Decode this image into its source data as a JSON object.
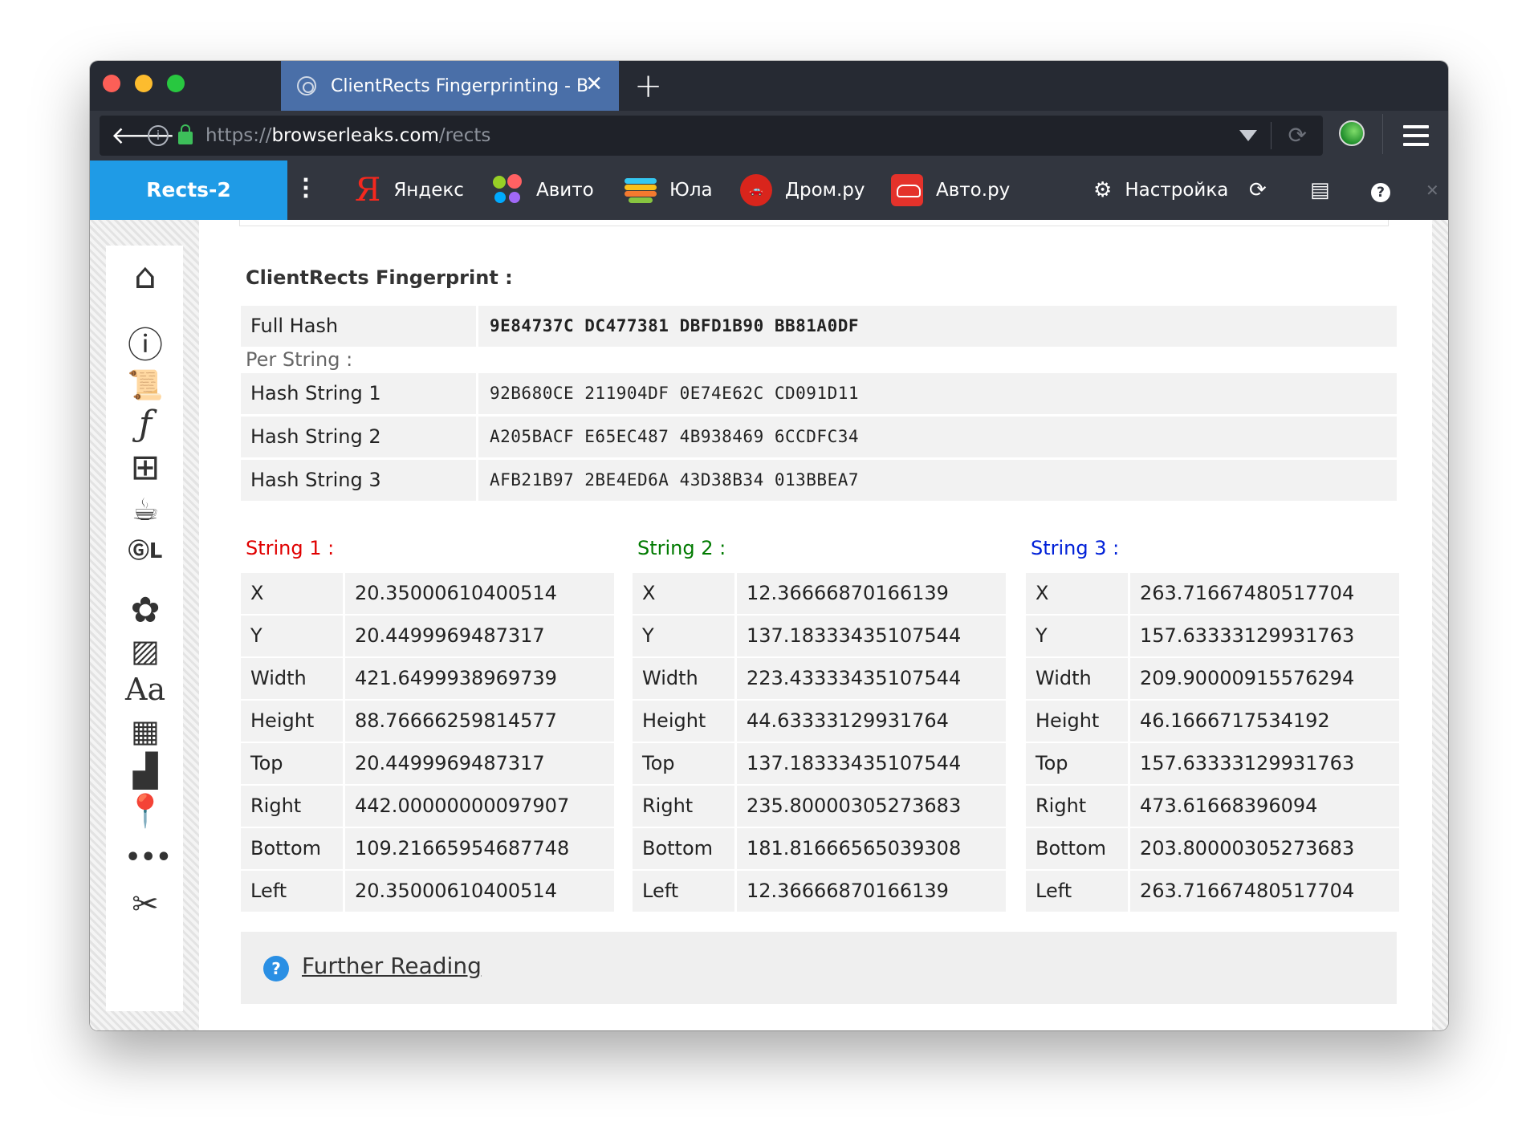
{
  "browser": {
    "tab_title": "ClientRects Fingerprinting - B",
    "url_scheme": "https://",
    "url_host": "browserleaks.com",
    "url_path": "/rects"
  },
  "bookmarks": {
    "active": "Rects-2",
    "items": [
      {
        "label": "Яндекс",
        "icon": "yandex-icon"
      },
      {
        "label": "Авито",
        "icon": "avito-icon"
      },
      {
        "label": "Юла",
        "icon": "yula-icon"
      },
      {
        "label": "Дром.ру",
        "icon": "drom-icon"
      },
      {
        "label": "Авто.ру",
        "icon": "autoru-icon"
      }
    ],
    "settings_label": "Настройка"
  },
  "sidebar": {
    "icons": [
      "home-icon",
      "info-icon",
      "javascript-icon",
      "flash-icon",
      "windows-icon",
      "java-icon",
      "webgl-icon",
      "canvas-icon",
      "image-icon",
      "fonts-icon",
      "firewall-icon",
      "stairs-icon",
      "location-icon",
      "more-icon",
      "tools-icon"
    ]
  },
  "fingerprint": {
    "title": "ClientRects Fingerprint :",
    "full_hash_label": "Full Hash",
    "full_hash": "9E84737C DC477381 DBFD1B90 BB81A0DF",
    "per_string_label": "Per String :",
    "strings": [
      {
        "label": "Hash String 1",
        "hash": "92B680CE 211904DF 0E74E62C CD091D11"
      },
      {
        "label": "Hash String 2",
        "hash": "A205BACF E65EC487 4B938469 6CCDFC34"
      },
      {
        "label": "Hash String 3",
        "hash": "AFB21B97 2BE4ED6A 43D38B34 013BBEA7"
      }
    ]
  },
  "rects": {
    "keys": [
      "X",
      "Y",
      "Width",
      "Height",
      "Top",
      "Right",
      "Bottom",
      "Left"
    ],
    "columns": [
      {
        "title": "String 1 :",
        "color": "#e00000",
        "values": [
          "20.35000610400514",
          "20.4499969487317",
          "421.6499938969739",
          "88.76666259814577",
          "20.4499969487317",
          "442.00000000097907",
          "109.21665954687748",
          "20.35000610400514"
        ]
      },
      {
        "title": "String 2 :",
        "color": "#007a00",
        "values": [
          "12.36666870166139",
          "137.18333435107544",
          "223.43333435107544",
          "44.63333129931764",
          "137.18333435107544",
          "235.80000305273683",
          "181.81666565039308",
          "12.36666870166139"
        ]
      },
      {
        "title": "String 3 :",
        "color": "#0020d8",
        "values": [
          "263.71667480517704",
          "157.63333129931763",
          "209.90000915576294",
          "46.1666717534192",
          "157.63333129931763",
          "473.61668396094",
          "203.80000305273683",
          "263.71667480517704"
        ]
      }
    ]
  },
  "further_reading": "Further Reading"
}
